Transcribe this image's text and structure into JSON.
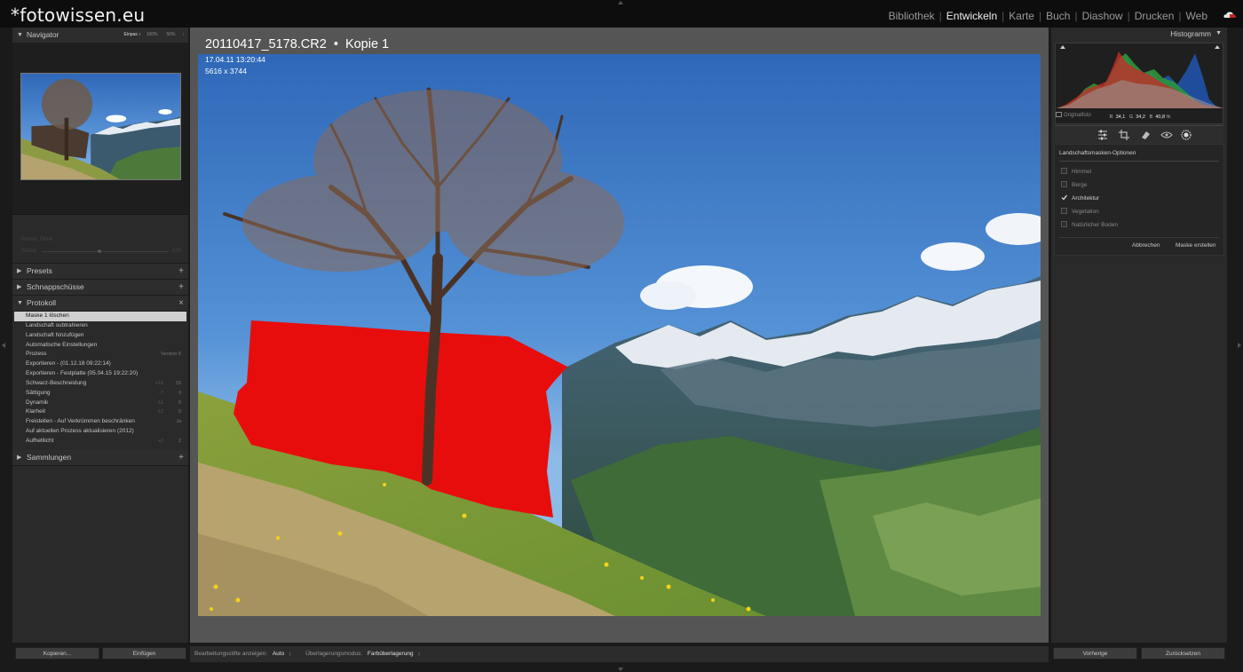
{
  "app": {
    "logo": "*fotowissen.eu",
    "modules": [
      {
        "label": "Bibliothek",
        "active": false
      },
      {
        "label": "Entwickeln",
        "active": true
      },
      {
        "label": "Karte",
        "active": false
      },
      {
        "label": "Buch",
        "active": false
      },
      {
        "label": "Diashow",
        "active": false
      },
      {
        "label": "Drucken",
        "active": false
      },
      {
        "label": "Web",
        "active": false
      }
    ]
  },
  "left": {
    "navigator": {
      "title": "Navigator",
      "zoom_options": [
        "Einpas ↕",
        "100%",
        "50%",
        "↕"
      ]
    },
    "grid_settings": {
      "label1": "Preset: Ohne",
      "label2": "Stärke",
      "value": "100",
      "strength": 1.0
    },
    "presets": {
      "title": "Presets"
    },
    "snapshots": {
      "title": "Schnappschüsse"
    },
    "history": {
      "title": "Protokoll",
      "items": [
        {
          "label": "Maske 1 löschen",
          "a": "",
          "b": "",
          "selected": true
        },
        {
          "label": "Landschaft subtrahieren",
          "a": "",
          "b": ""
        },
        {
          "label": "Landschaft hinzufügen",
          "a": "",
          "b": ""
        },
        {
          "label": "Automatische Einstellungen",
          "a": "",
          "b": ""
        },
        {
          "label": "Prozess",
          "a": "",
          "b": "Version 6"
        },
        {
          "label": "Exportieren - (01.12.18 09:22:14)",
          "a": "",
          "b": ""
        },
        {
          "label": "Exportieren - Festplatte (05.04.15 19:22:20)",
          "a": "",
          "b": ""
        },
        {
          "label": "Schwarz-Beschneidung",
          "a": "+15",
          "b": "15"
        },
        {
          "label": "Sättigung",
          "a": "-7",
          "b": "0"
        },
        {
          "label": "Dynamik",
          "a": "-11",
          "b": "0"
        },
        {
          "label": "Klarheit",
          "a": "-12",
          "b": "0"
        },
        {
          "label": "Freistellen - Auf Verkrümmen beschränken",
          "a": "",
          "b": "Ja"
        },
        {
          "label": "Auf aktuellen Prozess aktualisieren (2012)",
          "a": "",
          "b": ""
        },
        {
          "label": "Aufhelllicht",
          "a": "+2",
          "b": "2"
        }
      ]
    },
    "collections": {
      "title": "Sammlungen"
    },
    "buttons": {
      "copy": "Kopieren...",
      "paste": "Einfügen"
    }
  },
  "center": {
    "filename": "20110417_5178.CR2",
    "separator": "•",
    "copy_name": "Kopie 1",
    "datetime": "17.04.11 13:20:44",
    "dimensions": "5616 x 3744",
    "toolbar": {
      "pins_label": "Bearbeitungsstifte anzeigen:",
      "pins_value": "Auto",
      "overlay_label": "Überlagerungsmodus:",
      "overlay_value": "Farbüberlagerung",
      "dropdown_glyph": "↕"
    }
  },
  "right": {
    "histogram": {
      "title": "Histogramm",
      "r_label": "R",
      "r_value": "34,1",
      "g_label": "G",
      "g_value": "34,2",
      "b_label": "B",
      "b_value": "40,8",
      "percent": "%",
      "original_label": "Originalfoto"
    },
    "mask_options": {
      "title": "Landschaftsmasken-Optionen",
      "options": [
        {
          "label": "Himmel",
          "checked": false
        },
        {
          "label": "Berge",
          "checked": false
        },
        {
          "label": "Architektur",
          "checked": true
        },
        {
          "label": "Vegetation",
          "checked": false
        },
        {
          "label": "Natürlicher Boden",
          "checked": false
        }
      ],
      "cancel": "Abbrechen",
      "create": "Maske erstellen"
    },
    "buttons": {
      "previous": "Vorherige",
      "reset": "Zurücksetzen"
    }
  },
  "colors": {
    "mask_overlay": "#e80d0d",
    "sky_top": "#2f68b8",
    "panel_bg": "#2a2a2a",
    "canvas_bg": "#555555"
  }
}
